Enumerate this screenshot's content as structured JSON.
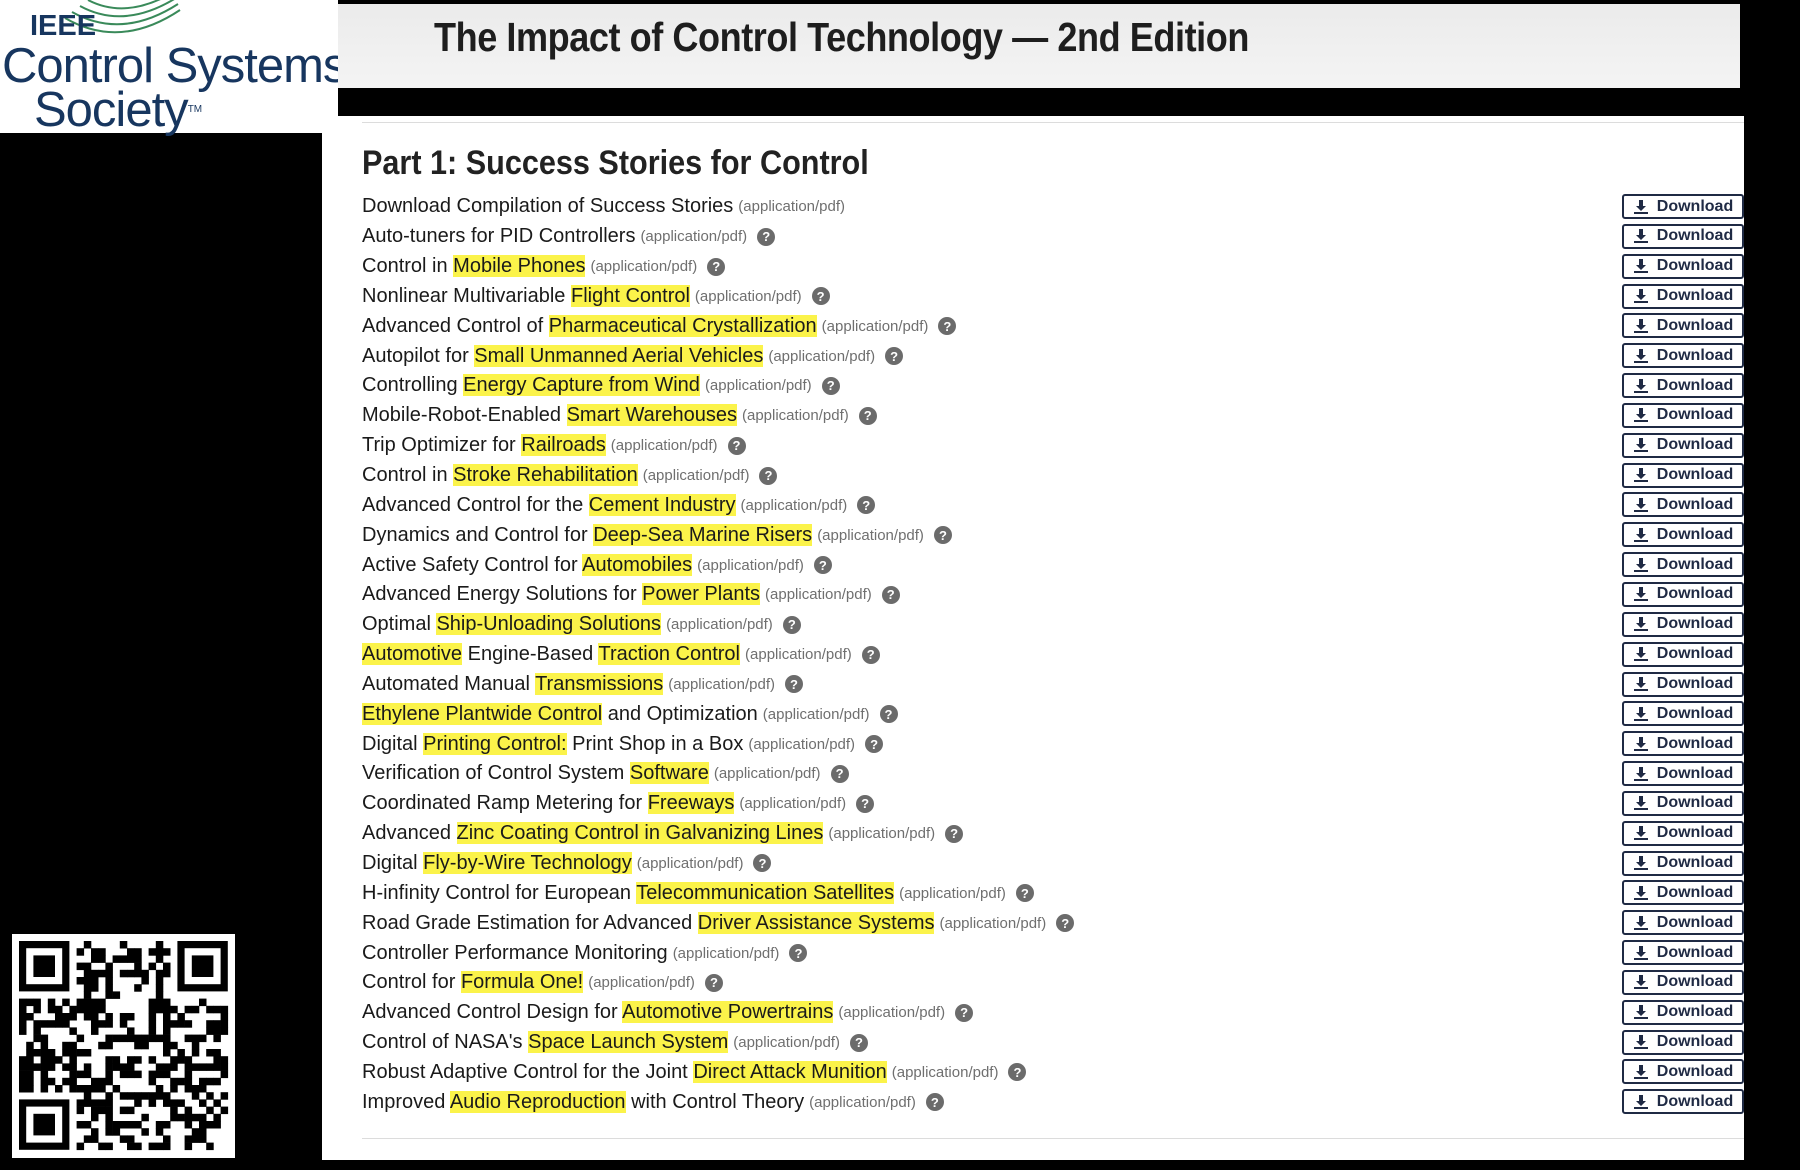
{
  "logo": {
    "line1": "IEEE",
    "line2": "Control Systems",
    "line3": "Society",
    "tm": "TM",
    "color": "#17365f"
  },
  "page": {
    "title": "The Impact of Control Technology — 2nd Edition"
  },
  "section": {
    "heading": "Part 1: Success Stories for Control"
  },
  "download_label": "Download",
  "colors": {
    "highlight": "#fbf34a",
    "button_border": "#1f2a44",
    "help_icon": "#6b6b6b"
  },
  "documents": [
    {
      "parts": [
        {
          "t": "Download Compilation of Success Stories"
        }
      ],
      "mime": "(application/pdf)",
      "help": false
    },
    {
      "parts": [
        {
          "t": "Auto-tuners for PID Controllers"
        }
      ],
      "mime": "(application/pdf)",
      "help": true
    },
    {
      "parts": [
        {
          "t": "Control in "
        },
        {
          "t": "Mobile Phones",
          "hl": true
        }
      ],
      "mime": "(application/pdf)",
      "help": true
    },
    {
      "parts": [
        {
          "t": "Nonlinear Multivariable "
        },
        {
          "t": "Flight Control",
          "hl": true
        }
      ],
      "mime": "(application/pdf)",
      "help": true
    },
    {
      "parts": [
        {
          "t": "Advanced Control of "
        },
        {
          "t": "Pharmaceutical Crystallization",
          "hl": true
        }
      ],
      "mime": "(application/pdf)",
      "help": true
    },
    {
      "parts": [
        {
          "t": "Autopilot for "
        },
        {
          "t": "Small Unmanned Aerial Vehicles",
          "hl": true
        }
      ],
      "mime": "(application/pdf)",
      "help": true
    },
    {
      "parts": [
        {
          "t": "Controlling "
        },
        {
          "t": "Energy Capture from Wind",
          "hl": true
        }
      ],
      "mime": "(application/pdf)",
      "help": true
    },
    {
      "parts": [
        {
          "t": "Mobile-Robot-Enabled "
        },
        {
          "t": "Smart Warehouses",
          "hl": true
        }
      ],
      "mime": "(application/pdf)",
      "help": true
    },
    {
      "parts": [
        {
          "t": "Trip Optimizer for "
        },
        {
          "t": "Railroads",
          "hl": true
        }
      ],
      "mime": "(application/pdf)",
      "help": true
    },
    {
      "parts": [
        {
          "t": "Control in "
        },
        {
          "t": "Stroke Rehabilitation",
          "hl": true
        }
      ],
      "mime": "(application/pdf)",
      "help": true
    },
    {
      "parts": [
        {
          "t": "Advanced Control for the "
        },
        {
          "t": "Cement Industry",
          "hl": true
        }
      ],
      "mime": "(application/pdf)",
      "help": true
    },
    {
      "parts": [
        {
          "t": "Dynamics and Control for "
        },
        {
          "t": "Deep-Sea Marine Risers",
          "hl": true
        }
      ],
      "mime": "(application/pdf)",
      "help": true
    },
    {
      "parts": [
        {
          "t": "Active Safety Control for "
        },
        {
          "t": "Automobiles",
          "hl": true
        }
      ],
      "mime": "(application/pdf)",
      "help": true
    },
    {
      "parts": [
        {
          "t": "Advanced Energy Solutions for "
        },
        {
          "t": "Power Plants",
          "hl": true
        }
      ],
      "mime": "(application/pdf)",
      "help": true
    },
    {
      "parts": [
        {
          "t": "Optimal "
        },
        {
          "t": "Ship-Unloading Solutions",
          "hl": true
        }
      ],
      "mime": "(application/pdf)",
      "help": true
    },
    {
      "parts": [
        {
          "t": "Automotive",
          "hl": true
        },
        {
          "t": " Engine-Based "
        },
        {
          "t": "Traction Control",
          "hl": true
        }
      ],
      "mime": "(application/pdf)",
      "help": true
    },
    {
      "parts": [
        {
          "t": "Automated Manual "
        },
        {
          "t": "Transmissions",
          "hl": true
        }
      ],
      "mime": "(application/pdf)",
      "help": true
    },
    {
      "parts": [
        {
          "t": "Ethylene Plantwide Control",
          "hl": true
        },
        {
          "t": " and Optimization"
        }
      ],
      "mime": "(application/pdf)",
      "help": true
    },
    {
      "parts": [
        {
          "t": "Digital "
        },
        {
          "t": "Printing Control:",
          "hl": true
        },
        {
          "t": " Print Shop in a Box"
        }
      ],
      "mime": "(application/pdf)",
      "help": true
    },
    {
      "parts": [
        {
          "t": "Verification of Control System "
        },
        {
          "t": "Software",
          "hl": true
        }
      ],
      "mime": "(application/pdf)",
      "help": true
    },
    {
      "parts": [
        {
          "t": "Coordinated Ramp Metering for "
        },
        {
          "t": "Freeways",
          "hl": true
        }
      ],
      "mime": "(application/pdf)",
      "help": true
    },
    {
      "parts": [
        {
          "t": "Advanced "
        },
        {
          "t": "Zinc Coating Control in Galvanizing Lines",
          "hl": true
        }
      ],
      "mime": "(application/pdf)",
      "help": true
    },
    {
      "parts": [
        {
          "t": "Digital "
        },
        {
          "t": "Fly-by-Wire Technology",
          "hl": true
        }
      ],
      "mime": "(application/pdf)",
      "help": true
    },
    {
      "parts": [
        {
          "t": "H-infinity Control for European "
        },
        {
          "t": "Telecommunication Satellites",
          "hl": true
        }
      ],
      "mime": "(application/pdf)",
      "help": true
    },
    {
      "parts": [
        {
          "t": "Road Grade Estimation for Advanced "
        },
        {
          "t": "Driver Assistance Systems",
          "hl": true
        }
      ],
      "mime": "(application/pdf)",
      "help": true
    },
    {
      "parts": [
        {
          "t": "Controller Performance Monitoring"
        }
      ],
      "mime": "(application/pdf)",
      "help": true
    },
    {
      "parts": [
        {
          "t": "Control for "
        },
        {
          "t": "Formula One!",
          "hl": true
        }
      ],
      "mime": "(application/pdf)",
      "help": true
    },
    {
      "parts": [
        {
          "t": "Advanced Control Design for "
        },
        {
          "t": "Automotive Powertrains",
          "hl": true
        }
      ],
      "mime": "(application/pdf)",
      "help": true
    },
    {
      "parts": [
        {
          "t": "Control of NASA's "
        },
        {
          "t": "Space Launch System",
          "hl": true
        }
      ],
      "mime": "(application/pdf)",
      "help": true
    },
    {
      "parts": [
        {
          "t": "Robust Adaptive Control for the Joint "
        },
        {
          "t": "Direct Attack Munition",
          "hl": true
        }
      ],
      "mime": "(application/pdf)",
      "help": true
    },
    {
      "parts": [
        {
          "t": "Improved "
        },
        {
          "t": "Audio Reproduction",
          "hl": true
        },
        {
          "t": " with Control Theory"
        }
      ],
      "mime": "(application/pdf)",
      "help": true
    }
  ]
}
